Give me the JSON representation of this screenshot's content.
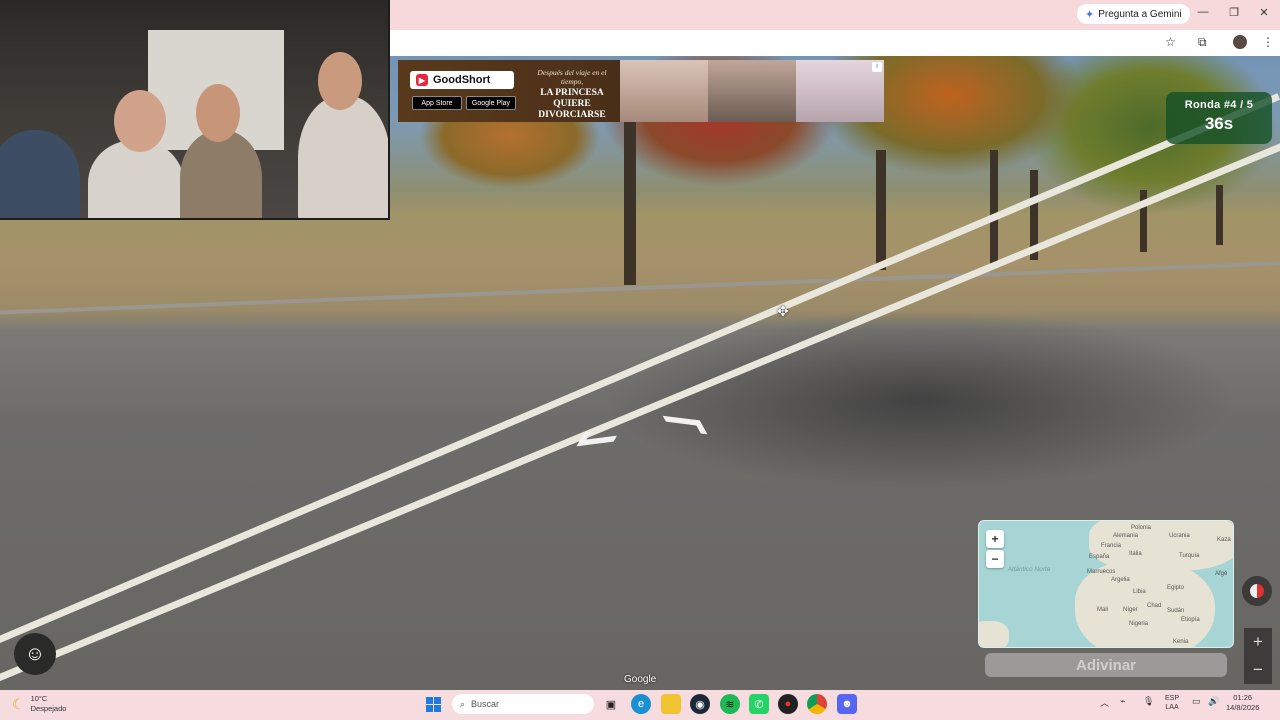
{
  "browser": {
    "gemini_label": "Pregunta a Gemini",
    "minimize": "—",
    "restore": "❐",
    "close": "✕",
    "bookmark_icon": "☆",
    "extensions_icon": "⧉",
    "menu_icon": "⋮"
  },
  "ad": {
    "brand": "GoodShort",
    "tagline": "Después del viaje en el tiempo,",
    "headline": "LA PRINCESA QUIERE DIVORCIARSE",
    "app_store": "App Store",
    "google_play": "Google Play",
    "info_icon": "i"
  },
  "game": {
    "round_label": "Ronda #4 / 5",
    "timer": "36s",
    "guess_button": "Adivinar",
    "zoom_in": "+",
    "zoom_out": "−",
    "side_zoom_in": "+",
    "side_zoom_out": "−",
    "emote_icon": "☺",
    "google_mark": "Google",
    "crosshair": "✥"
  },
  "map": {
    "labels": [
      "Polonia",
      "Alemania",
      "Ucrania",
      "Francia",
      "España",
      "Italia",
      "Turquía",
      "Marruecos",
      "Argelia",
      "Libia",
      "Egipto",
      "Mali",
      "Níger",
      "Chad",
      "Sudán",
      "Etiopía",
      "Nigeria",
      "Kenia",
      "Kaza",
      "Afgé"
    ],
    "ocean": "Atlántico Norte"
  },
  "taskbar": {
    "temperature": "10°C",
    "weather": "Despejado",
    "search_placeholder": "Buscar",
    "lang_top": "ESP",
    "lang_bottom": "LAA",
    "time": "01:26",
    "date": "14/8/2026"
  }
}
